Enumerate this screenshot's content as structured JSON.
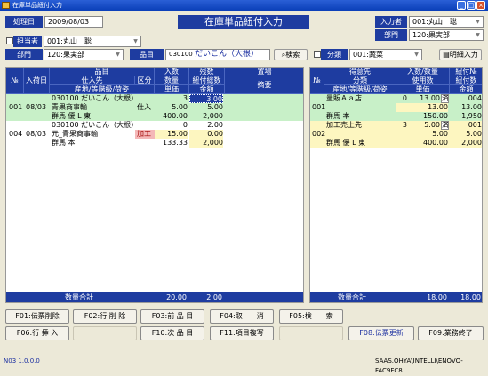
{
  "window": {
    "title": "在庫単品紐付入力",
    "min": "_",
    "max": "□",
    "close": "×"
  },
  "header": {
    "title": "在庫単品紐付入力",
    "proc_date_label": "処理日",
    "proc_date": "2009/08/03",
    "inputter_label": "入力者",
    "inputter": "001:丸山　聡",
    "dept_label": "部門",
    "dept": "120:果実部",
    "chk_person_label": "担当者",
    "chk_person": "001:丸山　聡",
    "dept2_label": "部門",
    "dept2": "120:果実部",
    "item_label": "品目",
    "item_code": "030100",
    "item_name": "だいこん（大根）",
    "search_label": "検索",
    "chk_class_label": "分類",
    "chk_class": "001:蔬菜",
    "detail_btn": "明細入力"
  },
  "left": {
    "headers": {
      "no": "№",
      "date": "入荷日",
      "item": "品目",
      "supplier": "仕入先",
      "kubun": "区分",
      "origin": "産地/等階級/荷姿",
      "qty_in": "入数",
      "qty": "数量",
      "price": "単価",
      "remain": "残数",
      "tie_total": "紐付総数",
      "amount": "金額",
      "place": "置場",
      "memo": "摘要"
    },
    "rows": [
      {
        "no": "001",
        "date": "08/03",
        "item": "030100 だいこん（大根）",
        "supplier": "青果商事輸",
        "kubun": "仕入",
        "origin": "群馬 優 L 東",
        "qty_in": "3",
        "qty": "5.00",
        "price": "400.00",
        "remain": "3.00",
        "tie": "5.00",
        "amount": "2,000"
      },
      {
        "no": "004",
        "date": "08/03",
        "item": "030100 だいこん（大根）",
        "supplier": "元_青果商事輸",
        "kubun": "加工",
        "origin": "群馬 本",
        "qty_in": "0",
        "qty": "15.00",
        "price": "133.33",
        "remain": "2.00",
        "tie": "0.00",
        "amount": "2,000"
      }
    ],
    "footer_label": "数量合計",
    "footer_qty": "20.00",
    "footer_remain": "2.00"
  },
  "right": {
    "headers": {
      "cust": "得意先",
      "qty_per": "入数/数量",
      "tie_no": "紐付№",
      "class": "分類",
      "use_qty": "使用数",
      "tie_count": "紐付数",
      "origin": "産地/等階級/荷姿",
      "price": "単価",
      "amount": "金額"
    },
    "rows": [
      {
        "no": "001",
        "cust": "量販Ａａ店",
        "qin": "0",
        "qty": "13.00",
        "flag": "済",
        "tie_no": "004",
        "use_qty": "13.00",
        "tie_count": "13.00",
        "origin": "群馬 本",
        "price": "150.00",
        "amount": "1,950"
      },
      {
        "no": "002",
        "cust": "加工売上先",
        "qin": "3",
        "qty": "5.00",
        "flag": "済",
        "tie_no": "001",
        "use_qty": "5.00",
        "tie_count": "5.00",
        "origin": "群馬 優 L 東",
        "price": "400.00",
        "amount": "2,000"
      }
    ],
    "footer_label": "数量合計",
    "footer_qty": "18.00",
    "footer_tie": "18.00"
  },
  "fkeys": {
    "f01": "F01:伝票削除",
    "f02": "F02:行 削 除",
    "f03": "F03:前 品 目",
    "f04": "F04:取　　消",
    "f05": "F05:検　　索",
    "f06": "F06:行 挿 入",
    "f10": "F10:次 品 目",
    "f11": "F11:項目複写",
    "f08": "F08:伝票更新",
    "f09": "F09:業務終了"
  },
  "status": {
    "left": "N03 1.0.0.0",
    "right": "SAAS.OHYA\\INTELLI\\ENOVO-FAC9FC8"
  }
}
